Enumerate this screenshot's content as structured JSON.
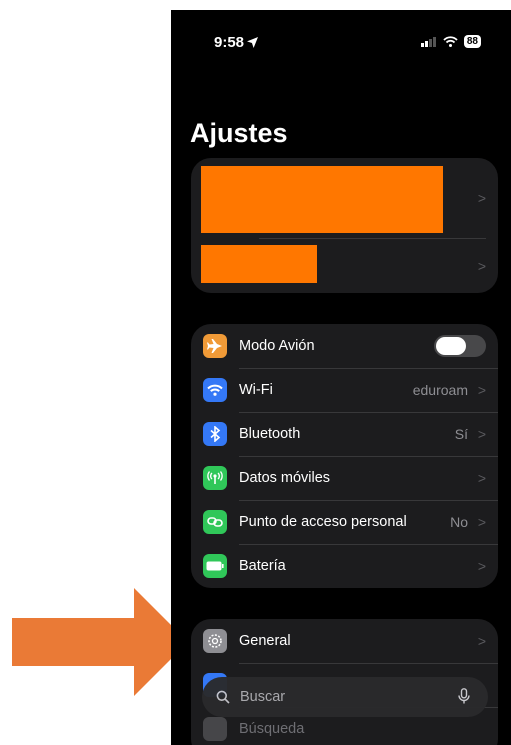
{
  "status": {
    "time": "9:58",
    "battery": "88"
  },
  "title": "Ajustes",
  "account_chevron_1": ">",
  "account_chevron_2": ">",
  "settings": [
    {
      "label": "Modo Avión",
      "value": "",
      "icon": "airplane-icon",
      "color": "#f09a37",
      "toggle": true
    },
    {
      "label": "Wi-Fi",
      "value": "eduroam",
      "icon": "wifi-icon",
      "color": "#3478f6"
    },
    {
      "label": "Bluetooth",
      "value": "Sí",
      "icon": "bluetooth-icon",
      "color": "#3478f6"
    },
    {
      "label": "Datos móviles",
      "value": "",
      "icon": "antenna-icon",
      "color": "#30c759"
    },
    {
      "label": "Punto de acceso personal",
      "value": "No",
      "icon": "hotspot-icon",
      "color": "#30c759"
    },
    {
      "label": "Batería",
      "value": "",
      "icon": "battery-icon",
      "color": "#30c759"
    }
  ],
  "general": {
    "label": "General",
    "icon": "gear-icon",
    "color": "#8e8e93"
  },
  "partial_row": {
    "label": "Búsqueda"
  },
  "search": {
    "placeholder": "Buscar"
  },
  "colors": {
    "arrow": "#ea7a36",
    "redaction": "#ff7700"
  }
}
